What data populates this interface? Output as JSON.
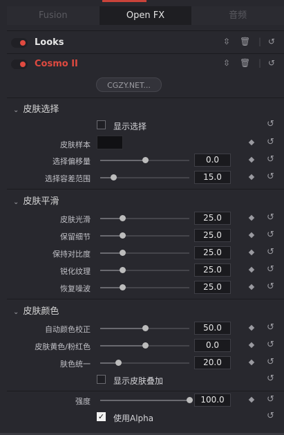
{
  "tabs": [
    "Fusion",
    "Open FX",
    "音频"
  ],
  "active_tab": 1,
  "effects": [
    {
      "name": "Looks",
      "color": "#e6e6e6"
    },
    {
      "name": "Cosmo II",
      "color": "#e04a40"
    }
  ],
  "brand_button": "CGZY.NET...",
  "sections": {
    "skin_select": "皮肤选择",
    "skin_smooth": "皮肤平滑",
    "skin_color": "皮肤颜色"
  },
  "show_selection": "显示选择",
  "skin_sample": "皮肤样本",
  "params": {
    "select_offset": {
      "label": "选择偏移量",
      "value": "0.0",
      "fill": 0.5
    },
    "select_range": {
      "label": "选择容差范围",
      "value": "15.0",
      "fill": 0.15
    },
    "smooth": {
      "label": "皮肤光滑",
      "value": "25.0",
      "fill": 0.25
    },
    "detail": {
      "label": "保留细节",
      "value": "25.0",
      "fill": 0.25
    },
    "contrast": {
      "label": "保持对比度",
      "value": "25.0",
      "fill": 0.25
    },
    "sharpen": {
      "label": "锐化纹理",
      "value": "25.0",
      "fill": 0.25
    },
    "restore": {
      "label": "恢复噪波",
      "value": "25.0",
      "fill": 0.25
    },
    "auto_color": {
      "label": "自动颜色校正",
      "value": "50.0",
      "fill": 0.5
    },
    "yellow_pink": {
      "label": "皮肤黄色/粉红色",
      "value": "0.0",
      "fill": 0.5
    },
    "uniform": {
      "label": "肤色统一",
      "value": "20.0",
      "fill": 0.2
    },
    "strength": {
      "label": "强度",
      "value": "100.0",
      "fill": 1.0
    }
  },
  "show_skin_overlay": "显示皮肤叠加",
  "use_alpha": "使用Alpha",
  "use_alpha_checked": true
}
